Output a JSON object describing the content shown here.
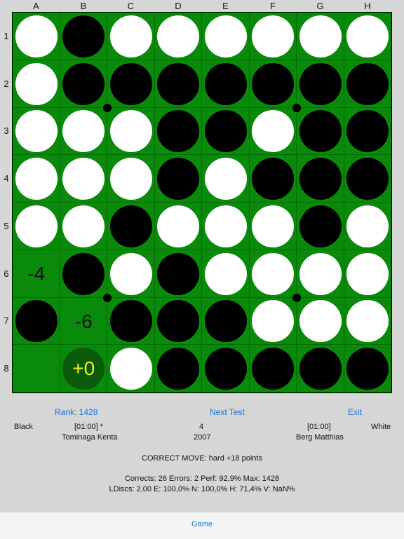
{
  "columns": [
    "A",
    "B",
    "C",
    "D",
    "E",
    "F",
    "G",
    "H"
  ],
  "rows": [
    "1",
    "2",
    "3",
    "4",
    "5",
    "6",
    "7",
    "8"
  ],
  "board": [
    [
      "W",
      "B",
      "W",
      "W",
      "W",
      "W",
      "W",
      "W"
    ],
    [
      "W",
      "B",
      "B",
      "B",
      "B",
      "B",
      "B",
      "B"
    ],
    [
      "W",
      "W",
      "W",
      "B",
      "B",
      "W",
      "B",
      "B"
    ],
    [
      "W",
      "W",
      "W",
      "B",
      "W",
      "B",
      "B",
      "B"
    ],
    [
      "W",
      "W",
      "B",
      "W",
      "W",
      "W",
      "B",
      "W"
    ],
    [
      "-4",
      "B",
      "W",
      "B",
      "W",
      "W",
      "W",
      "W"
    ],
    [
      "B",
      "-6",
      "B",
      "B",
      "B",
      "W",
      "W",
      "W"
    ],
    [
      "",
      "+0",
      "W",
      "B",
      "B",
      "B",
      "B",
      "B"
    ]
  ],
  "colors": {
    "board_green": "#0a8a0a",
    "best_move_bg": "#0a5a0a",
    "best_move_text": "#f0f020",
    "link_blue": "#1e73d8"
  },
  "toolbar": {
    "rank": "Rank: 1428",
    "next_test": "Next Test",
    "exit": "Exit"
  },
  "players": {
    "black_label": "Black",
    "black_clock": "[01:00] *",
    "black_name": "Tominaga Kenta",
    "move_number": "4",
    "year": "2007",
    "white_clock": "[01:00]",
    "white_label": "White",
    "white_name": "Berg Matthias"
  },
  "result": {
    "correct_move": "CORRECT MOVE:  hard  +18 points",
    "stats_line": "Corrects: 26  Errors: 2  Perf: 92,9%  Max: 1428",
    "ldiscs_line": "LDiscs: 2,00  E: 100,0%  N: 100,0%  H: 71,4%  V: NaN%"
  },
  "tabbar": {
    "game": "Game"
  }
}
